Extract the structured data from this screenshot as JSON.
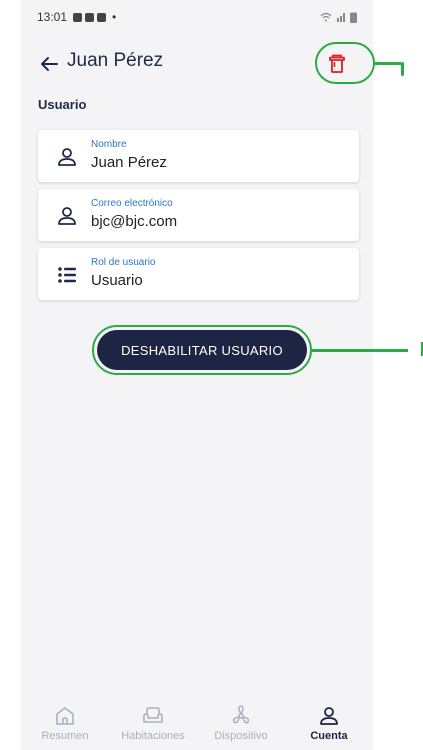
{
  "status_bar": {
    "time": "13:01",
    "dot": "•"
  },
  "header": {
    "title": "Juan Pérez",
    "back_icon": "arrow-left-icon",
    "delete_icon": "trash-icon"
  },
  "section": {
    "label": "Usuario"
  },
  "fields": [
    {
      "label": "Nombre",
      "value": "Juan Pérez",
      "icon": "person-icon"
    },
    {
      "label": "Correo electrónico",
      "value": "bjc@bjc.com",
      "icon": "person-icon"
    },
    {
      "label": "Rol de usuario",
      "value": "Usuario",
      "icon": "list-icon"
    }
  ],
  "actions": {
    "disable_label": "DESHABILITAR USUARIO"
  },
  "nav": {
    "items": [
      {
        "label": "Resumen",
        "icon": "home-icon",
        "active": false
      },
      {
        "label": "Habitaciones",
        "icon": "armchair-icon",
        "active": false
      },
      {
        "label": "Dispositivo",
        "icon": "fan-icon",
        "active": false
      },
      {
        "label": "Cuenta",
        "icon": "person-icon",
        "active": true
      }
    ]
  },
  "colors": {
    "accent": "#1e2444",
    "delete": "#e02020",
    "annotation": "#2eaa44",
    "link": "#2a78c2"
  }
}
